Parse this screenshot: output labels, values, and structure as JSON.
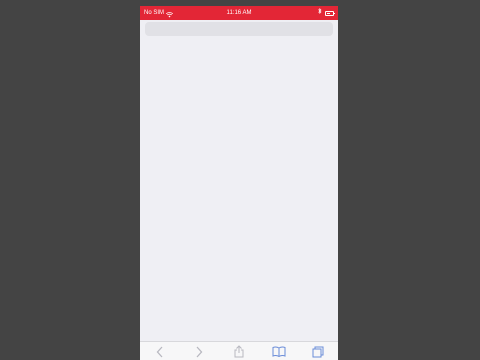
{
  "status_bar": {
    "carrier": "No SIM",
    "time": "11:16 AM",
    "background_color": "#e32636",
    "icons": [
      "wifi-icon",
      "bluetooth-icon",
      "battery-icon"
    ]
  },
  "toolbar": {
    "buttons": [
      {
        "name": "back",
        "icon": "chevron-left-icon",
        "enabled": false
      },
      {
        "name": "forward",
        "icon": "chevron-right-icon",
        "enabled": false
      },
      {
        "name": "share",
        "icon": "share-icon",
        "enabled": false
      },
      {
        "name": "bookmarks",
        "icon": "book-icon",
        "enabled": true
      },
      {
        "name": "tabs",
        "icon": "tabs-icon",
        "enabled": true
      }
    ]
  },
  "colors": {
    "frame_background": "#444444",
    "page_background": "#efeff4",
    "toolbar_accent": "#6a8cd8"
  }
}
